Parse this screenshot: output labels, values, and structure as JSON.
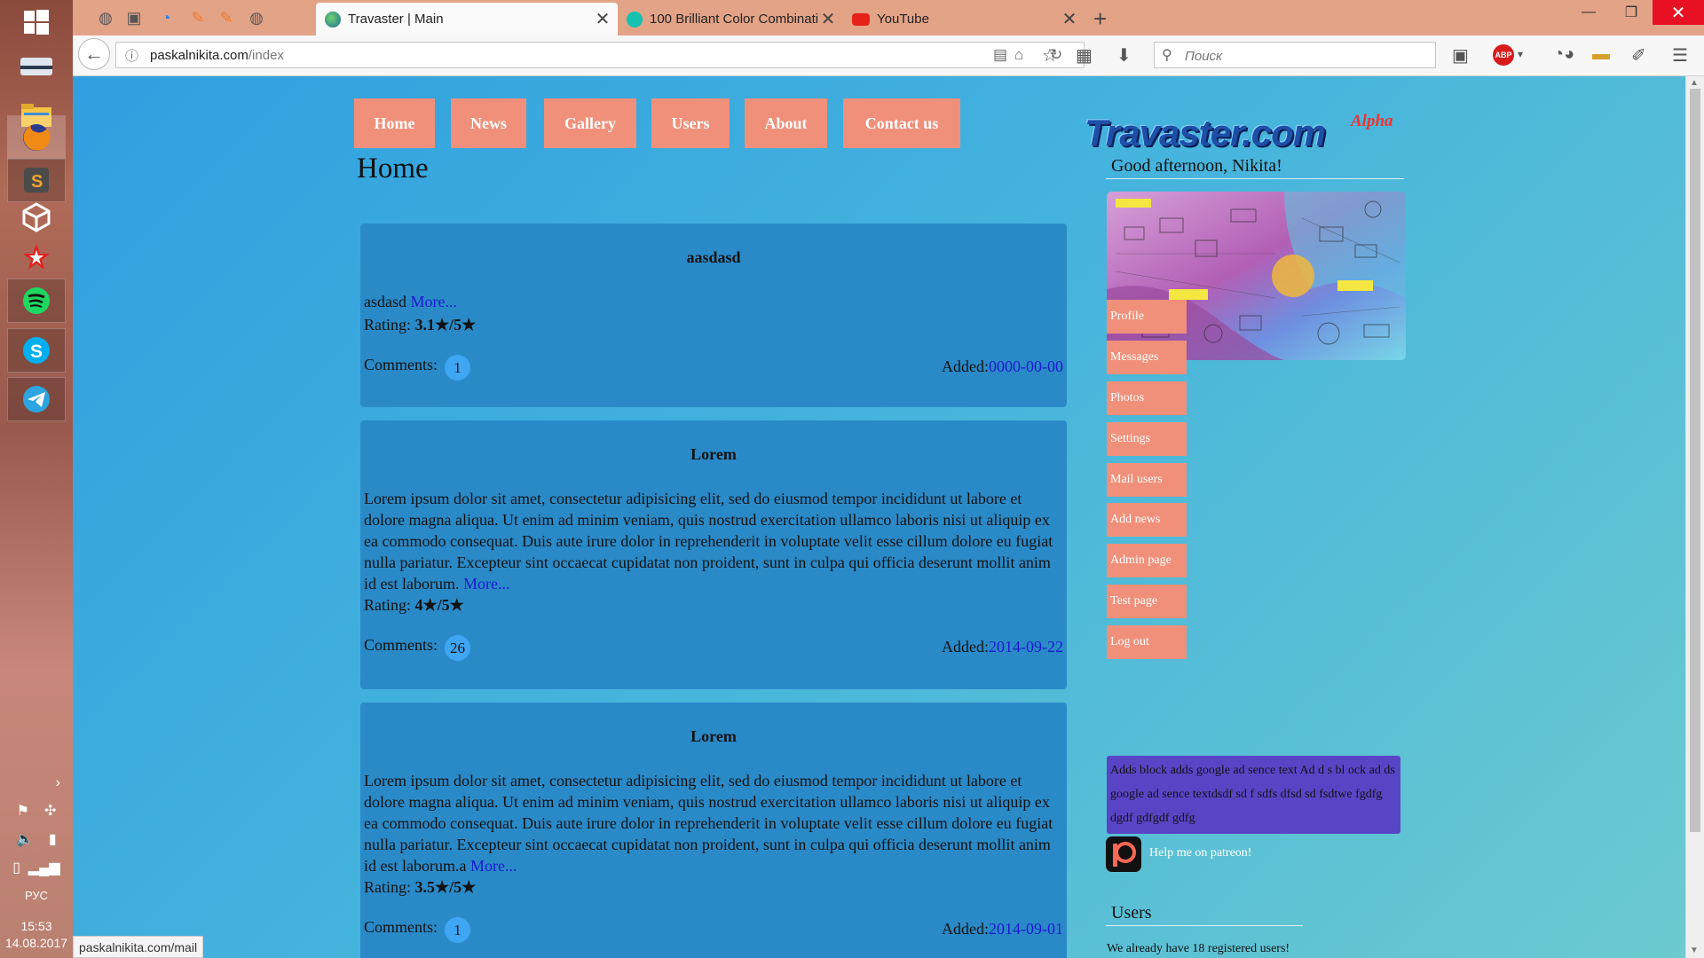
{
  "os": {
    "language": "РУС",
    "time": "15:53",
    "date": "14.08.2017",
    "taskbar_icons": [
      "windows-start-icon",
      "desktop-drive-icon",
      "file-explorer-icon",
      "firefox-icon",
      "sublime-text-icon",
      "unity-icon",
      "pokerstars-icon",
      "spotify-icon",
      "skype-icon",
      "telegram-icon"
    ]
  },
  "browser": {
    "tabs": [
      {
        "title": "Travaster | Main",
        "active": true
      },
      {
        "title": "100 Brilliant Color Combinati",
        "active": false
      },
      {
        "title": "YouTube",
        "active": false
      }
    ],
    "url_host": "paskalnikita.com",
    "url_path": "/index",
    "search_placeholder": "Поиск",
    "abp_label": "ABP",
    "status_link": "paskalnikita.com/mail"
  },
  "site": {
    "nav": [
      "Home",
      "News",
      "Gallery",
      "Users",
      "About",
      "Contact us"
    ],
    "page_title": "Home",
    "posts": [
      {
        "title": "aasdasd",
        "body": "asdasd",
        "more": "More...",
        "rating_label": "Rating:",
        "rating": "3.1★/5★",
        "comments_label": "Comments:",
        "comments": "1",
        "added_label": "Added:",
        "date": "0000-00-00"
      },
      {
        "title": "Lorem",
        "body": "Lorem ipsum dolor sit amet, consectetur adipisicing elit, sed do eiusmod tempor incididunt ut labore et dolore magna aliqua. Ut enim ad minim veniam, quis nostrud exercitation ullamco laboris nisi ut aliquip ex ea commodo consequat. Duis aute irure dolor in reprehenderit in voluptate velit esse cillum dolore eu fugiat nulla pariatur. Excepteur sint occaecat cupidatat non proident, sunt in culpa qui officia deserunt mollit anim id est laborum.",
        "more": "More...",
        "rating_label": "Rating:",
        "rating": "4★/5★",
        "comments_label": "Comments:",
        "comments": "26",
        "added_label": "Added:",
        "date": "2014-09-22"
      },
      {
        "title": "Lorem",
        "body": "Lorem ipsum dolor sit amet, consectetur adipisicing elit, sed do eiusmod tempor incididunt ut labore et dolore magna aliqua. Ut enim ad minim veniam, quis nostrud exercitation ullamco laboris nisi ut aliquip ex ea commodo consequat. Duis aute irure dolor in reprehenderit in voluptate velit esse cillum dolore eu fugiat nulla pariatur. Excepteur sint occaecat cupidatat non proident, sunt in culpa qui officia deserunt mollit anim id est laborum.a",
        "more": "More...",
        "rating_label": "Rating:",
        "rating": "3.5★/5★",
        "comments_label": "Comments:",
        "comments": "1",
        "added_label": "Added:",
        "date": "2014-09-01"
      }
    ],
    "sidebar": {
      "logo": "Travaster.com",
      "badge": "Alpha",
      "greeting": "Good afternoon, Nikita!",
      "menu": [
        "Profile",
        "Messages",
        "Photos",
        "Settings",
        "Mail users",
        "Add news",
        "Admin page",
        "Test page",
        "Log out"
      ],
      "ad_text": "Adds block adds google ad sence text Ad d s bl ock ad ds google ad sence textdsdf sd f sdfs dfsd sd fsdtwe fgdfg dgdf gdfgdf gdfg",
      "patreon": "Help me on patreon!",
      "users_heading": "Users",
      "users_count": "We already have 18 registered users!"
    }
  },
  "colors": {
    "tab_strip": "#e3a387",
    "button": "#f0907a",
    "post_bg": "#2a8ac8",
    "badge": "#3ea6f3",
    "link": "#1a1acf",
    "ad_bg": "#5a44c6"
  }
}
